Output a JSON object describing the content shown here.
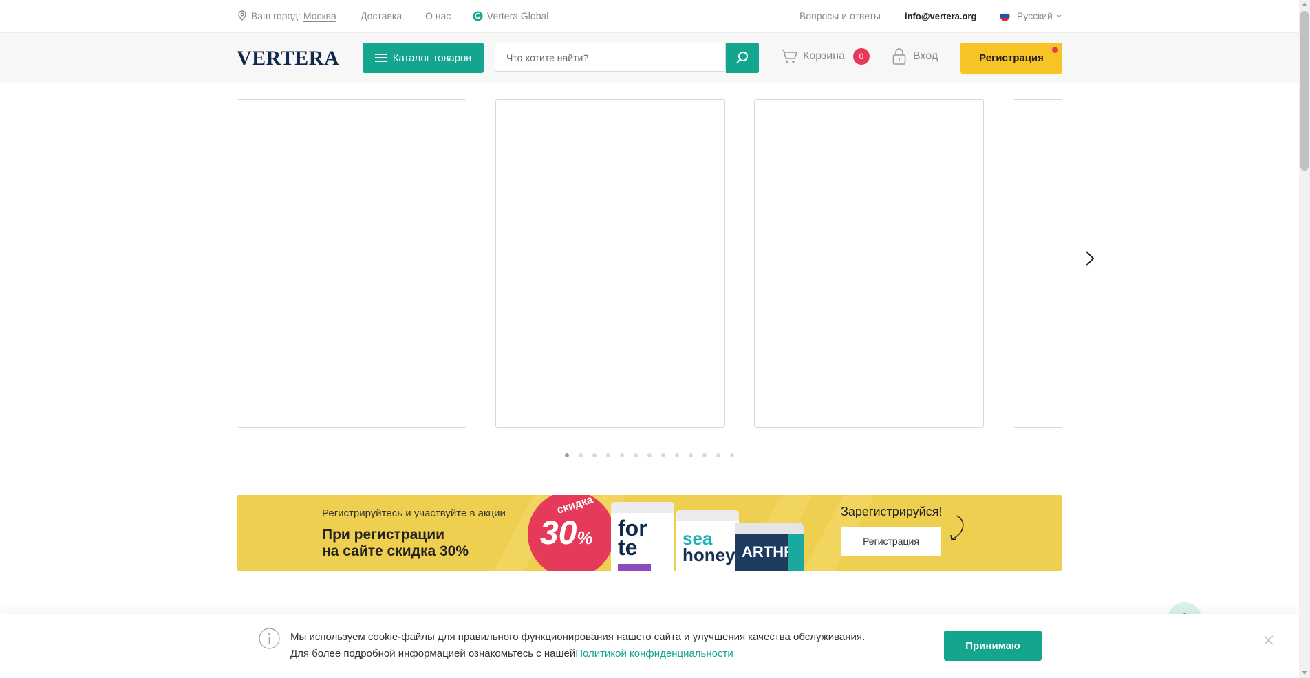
{
  "topbar": {
    "city_label": "Ваш город:",
    "city_value": "Москва",
    "delivery": "Доставка",
    "about": "О нас",
    "global": "Vertera Global",
    "faq": "Вопросы и ответы",
    "email": "info@vertera.org",
    "language": "Русский"
  },
  "header": {
    "logo": "VERTERA",
    "catalog": "Каталог товаров",
    "search_placeholder": "Что хотите найти?",
    "cart_label": "Корзина",
    "cart_count": "0",
    "login": "Вход",
    "register": "Регистрация"
  },
  "carousel": {
    "slide_count": 13,
    "active_slide": 1
  },
  "banner": {
    "subtitle": "Регистрируйтесь и участвуйте в акции",
    "title_line1": "При регистрации",
    "title_line2": "на сайте скидка 30%",
    "badge_word": "скидка",
    "badge_number": "30",
    "badge_percent": "%",
    "product_forte_1": "for",
    "product_forte_2": "te",
    "product_sea_1": "sea",
    "product_sea_2": "honey",
    "product_arthro": "ARTHRO",
    "cta_text": "Зарегистрируйся!",
    "cta_button": "Регистрация"
  },
  "cookie": {
    "line1": "Мы используем cookie-файлы для правильного функционирования нашего сайта и улучшения качества обслуживания.",
    "line2": "Для более подробной информацией ознакомьтесь с нашей",
    "link": "Политикой конфиденциальности",
    "accept": "Принимаю"
  },
  "colors": {
    "accent": "#14a58e",
    "yellow": "#f7c325",
    "banner_bg": "#eecf4f",
    "badge": "#e63a5a",
    "logo": "#13294b"
  }
}
